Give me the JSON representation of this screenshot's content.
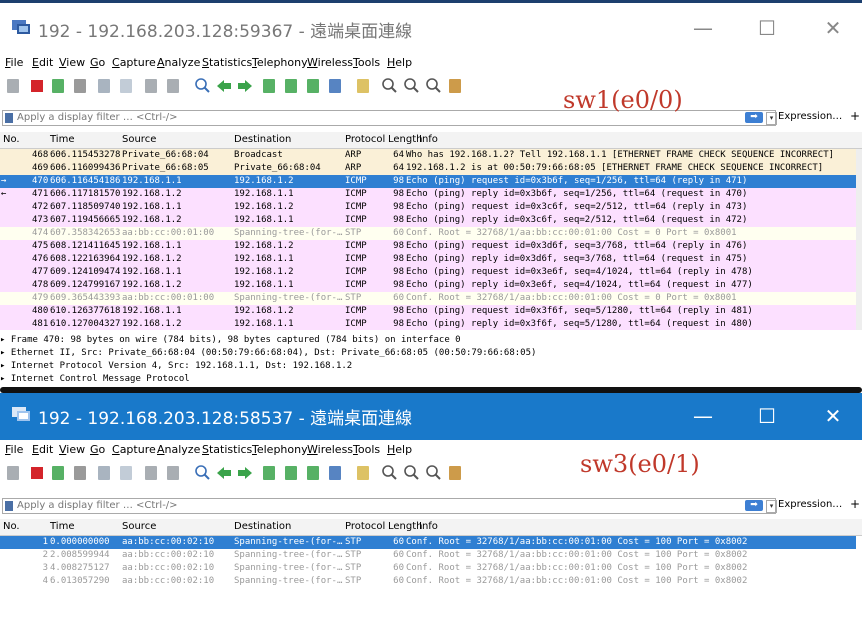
{
  "window1": {
    "title": "192 - 192.168.203.128:59367 - 遠端桌面連線",
    "annotation": "sw1(e0/0)",
    "packets": [
      {
        "no": "468",
        "time": "606.115453278",
        "source": "Private_66:68:04",
        "destination": "Broadcast",
        "protocol": "ARP",
        "length": "64",
        "info": "Who has 192.168.1.2? Tell 192.168.1.1 [ETHERNET FRAME CHECK SEQUENCE INCORRECT]",
        "style": "arp",
        "mark": ""
      },
      {
        "no": "469",
        "time": "606.116099436",
        "source": "Private_66:68:05",
        "destination": "Private_66:68:04",
        "protocol": "ARP",
        "length": "64",
        "info": "192.168.1.2 is at 00:50:79:66:68:05 [ETHERNET FRAME CHECK SEQUENCE INCORRECT]",
        "style": "arp",
        "mark": ""
      },
      {
        "no": "470",
        "time": "606.116454186",
        "source": "192.168.1.1",
        "destination": "192.168.1.2",
        "protocol": "ICMP",
        "length": "98",
        "info": "Echo (ping) request  id=0x3b6f, seq=1/256, ttl=64 (reply in 471)",
        "style": "selected",
        "mark": "→"
      },
      {
        "no": "471",
        "time": "606.117181570",
        "source": "192.168.1.2",
        "destination": "192.168.1.1",
        "protocol": "ICMP",
        "length": "98",
        "info": "Echo (ping) reply    id=0x3b6f, seq=1/256, ttl=64 (request in 470)",
        "style": "icmp",
        "mark": "←"
      },
      {
        "no": "472",
        "time": "607.118509740",
        "source": "192.168.1.1",
        "destination": "192.168.1.2",
        "protocol": "ICMP",
        "length": "98",
        "info": "Echo (ping) request  id=0x3c6f, seq=2/512, ttl=64 (reply in 473)",
        "style": "icmp",
        "mark": ""
      },
      {
        "no": "473",
        "time": "607.119456665",
        "source": "192.168.1.2",
        "destination": "192.168.1.1",
        "protocol": "ICMP",
        "length": "98",
        "info": "Echo (ping) reply    id=0x3c6f, seq=2/512, ttl=64 (request in 472)",
        "style": "icmp",
        "mark": ""
      },
      {
        "no": "474",
        "time": "607.358342653",
        "source": "aa:bb:cc:00:01:00",
        "destination": "Spanning-tree-(for-…",
        "protocol": "STP",
        "length": "60",
        "info": "Conf. Root = 32768/1/aa:bb:cc:00:01:00  Cost = 0  Port = 0x8001",
        "style": "stp",
        "mark": ""
      },
      {
        "no": "475",
        "time": "608.121411645",
        "source": "192.168.1.1",
        "destination": "192.168.1.2",
        "protocol": "ICMP",
        "length": "98",
        "info": "Echo (ping) request  id=0x3d6f, seq=3/768, ttl=64 (reply in 476)",
        "style": "icmp",
        "mark": ""
      },
      {
        "no": "476",
        "time": "608.122163964",
        "source": "192.168.1.2",
        "destination": "192.168.1.1",
        "protocol": "ICMP",
        "length": "98",
        "info": "Echo (ping) reply    id=0x3d6f, seq=3/768, ttl=64 (request in 475)",
        "style": "icmp",
        "mark": ""
      },
      {
        "no": "477",
        "time": "609.124109474",
        "source": "192.168.1.1",
        "destination": "192.168.1.2",
        "protocol": "ICMP",
        "length": "98",
        "info": "Echo (ping) request  id=0x3e6f, seq=4/1024, ttl=64 (reply in 478)",
        "style": "icmp",
        "mark": ""
      },
      {
        "no": "478",
        "time": "609.124799167",
        "source": "192.168.1.2",
        "destination": "192.168.1.1",
        "protocol": "ICMP",
        "length": "98",
        "info": "Echo (ping) reply    id=0x3e6f, seq=4/1024, ttl=64 (request in 477)",
        "style": "icmp",
        "mark": ""
      },
      {
        "no": "479",
        "time": "609.365443393",
        "source": "aa:bb:cc:00:01:00",
        "destination": "Spanning-tree-(for-…",
        "protocol": "STP",
        "length": "60",
        "info": "Conf. Root = 32768/1/aa:bb:cc:00:01:00  Cost = 0  Port = 0x8001",
        "style": "stp",
        "mark": ""
      },
      {
        "no": "480",
        "time": "610.126377618",
        "source": "192.168.1.1",
        "destination": "192.168.1.2",
        "protocol": "ICMP",
        "length": "98",
        "info": "Echo (ping) request  id=0x3f6f, seq=5/1280, ttl=64 (reply in 481)",
        "style": "icmp",
        "mark": ""
      },
      {
        "no": "481",
        "time": "610.127004327",
        "source": "192.168.1.2",
        "destination": "192.168.1.1",
        "protocol": "ICMP",
        "length": "98",
        "info": "Echo (ping) reply    id=0x3f6f, seq=5/1280, ttl=64 (request in 480)",
        "style": "icmp",
        "mark": ""
      }
    ],
    "details": [
      "Frame 470: 98 bytes on wire (784 bits), 98 bytes captured (784 bits) on interface 0",
      "Ethernet II, Src: Private_66:68:04 (00:50:79:66:68:04), Dst: Private_66:68:05 (00:50:79:66:68:05)",
      "Internet Protocol Version 4, Src: 192.168.1.1, Dst: 192.168.1.2",
      "Internet Control Message Protocol"
    ]
  },
  "window2": {
    "title": "192 - 192.168.203.128:58537 - 遠端桌面連線",
    "annotation": "sw3(e0/1)",
    "packets": [
      {
        "no": "1",
        "time": "0.000000000",
        "source": "aa:bb:cc:00:02:10",
        "destination": "Spanning-tree-(for-…",
        "protocol": "STP",
        "length": "60",
        "info": "Conf. Root = 32768/1/aa:bb:cc:00:01:00  Cost = 100  Port = 0x8002",
        "style": "selected",
        "mark": ""
      },
      {
        "no": "2",
        "time": "2.008599944",
        "source": "aa:bb:cc:00:02:10",
        "destination": "Spanning-tree-(for-…",
        "protocol": "STP",
        "length": "60",
        "info": "Conf. Root = 32768/1/aa:bb:cc:00:01:00  Cost = 100  Port = 0x8002",
        "style": "stpw",
        "mark": ""
      },
      {
        "no": "3",
        "time": "4.008275127",
        "source": "aa:bb:cc:00:02:10",
        "destination": "Spanning-tree-(for-…",
        "protocol": "STP",
        "length": "60",
        "info": "Conf. Root = 32768/1/aa:bb:cc:00:01:00  Cost = 100  Port = 0x8002",
        "style": "stpw",
        "mark": ""
      },
      {
        "no": "4",
        "time": "6.013057290",
        "source": "aa:bb:cc:00:02:10",
        "destination": "Spanning-tree-(for-…",
        "protocol": "STP",
        "length": "60",
        "info": "Conf. Root = 32768/1/aa:bb:cc:00:01:00  Cost = 100  Port = 0x8002",
        "style": "stpw",
        "mark": ""
      }
    ]
  },
  "menu": [
    "File",
    "Edit",
    "View",
    "Go",
    "Capture",
    "Analyze",
    "Statistics",
    "Telephony",
    "Wireless",
    "Tools",
    "Help"
  ],
  "filter": {
    "placeholder": "Apply a display filter … <Ctrl-/>",
    "expression": "Expression…",
    "plus": "+"
  },
  "columns": {
    "no": "No.",
    "time": "Time",
    "source": "Source",
    "destination": "Destination",
    "protocol": "Protocol",
    "length": "Length",
    "info": "Info"
  },
  "window_controls": {
    "minimize": "—",
    "maximize": "☐",
    "close": "✕"
  },
  "colors": {
    "arp": "#faf0d7",
    "icmp": "#fce0ff",
    "stp": "#fffff0",
    "selected": "#2f7fd2",
    "title_active": "#1979ca"
  }
}
